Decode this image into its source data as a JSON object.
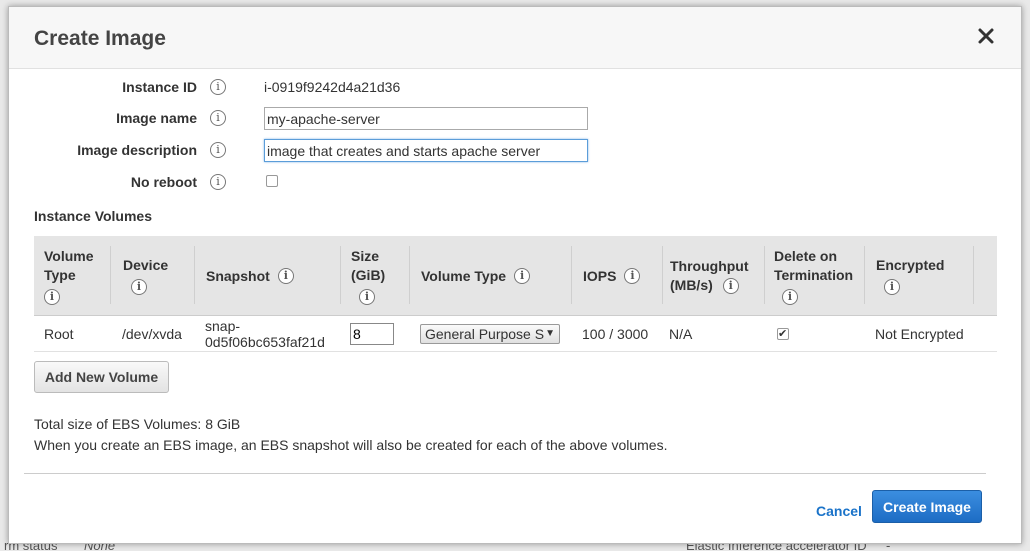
{
  "background": {
    "bottom_left_label": "rm status",
    "bottom_left_value": "None",
    "bottom_right_label": "Elastic Inference accelerator ID",
    "bottom_right_value": "-"
  },
  "modal": {
    "title": "Create Image",
    "close_icon": "close-icon"
  },
  "form": {
    "instance_id": {
      "label": "Instance ID",
      "value": "i-0919f9242d4a21d36"
    },
    "image_name": {
      "label": "Image name",
      "value": "my-apache-server"
    },
    "image_description": {
      "label": "Image description",
      "value": "image that creates and starts apache server"
    },
    "no_reboot": {
      "label": "No reboot",
      "checked": false
    },
    "info_glyph": "i"
  },
  "volumes": {
    "section_title": "Instance Volumes",
    "headers": {
      "volume_type_1": "Volume",
      "volume_type_2": "Type",
      "device": "Device",
      "snapshot": "Snapshot",
      "size_1": "Size",
      "size_2": "(GiB)",
      "volume_type": "Volume Type",
      "iops": "IOPS",
      "throughput_1": "Throughput",
      "throughput_2": "(MB/s)",
      "delete_1": "Delete on",
      "delete_2": "Termination",
      "encrypted": "Encrypted"
    },
    "rows": [
      {
        "volume_type": "Root",
        "device": "/dev/xvda",
        "snapshot_1": "snap-",
        "snapshot_2": "0d5f06bc653faf21d",
        "size": "8",
        "volume_kind": "General Purpose S",
        "iops": "100 / 3000",
        "throughput": "N/A",
        "delete_on_termination": true,
        "encrypted": "Not Encrypted"
      }
    ],
    "add_button": "Add New Volume"
  },
  "summary": {
    "total": "Total size of EBS Volumes: 8 GiB",
    "note": "When you create an EBS image, an EBS snapshot will also be created for each of the above volumes."
  },
  "footer": {
    "cancel": "Cancel",
    "create": "Create Image"
  },
  "colors": {
    "primary": "#1d6cc4",
    "link": "#1a73c9"
  }
}
